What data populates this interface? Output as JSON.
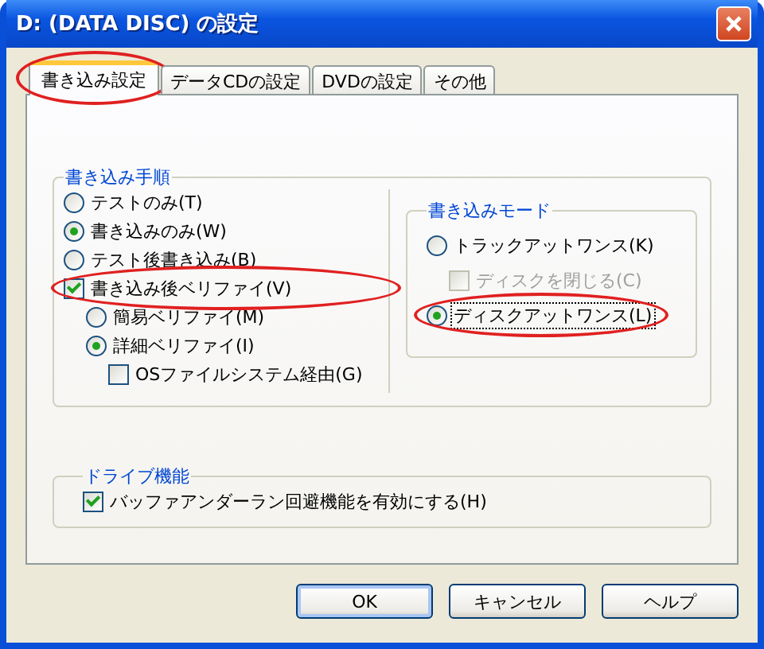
{
  "window": {
    "title": "D: (DATA DISC) の設定"
  },
  "tabs": [
    {
      "label": "書き込み設定",
      "selected": true,
      "circled": true
    },
    {
      "label": "データCDの設定",
      "selected": false,
      "circled": false
    },
    {
      "label": "DVDの設定",
      "selected": false,
      "circled": false
    },
    {
      "label": "その他",
      "selected": false,
      "circled": false
    }
  ],
  "write_procedure": {
    "title": "書き込み手順",
    "methods": [
      {
        "label": "テストのみ(T)",
        "selected": false
      },
      {
        "label": "書き込みのみ(W)",
        "selected": true
      },
      {
        "label": "テスト後書き込み(B)",
        "selected": false
      }
    ],
    "verify": {
      "label": "書き込み後ベリファイ(V)",
      "checked": true,
      "circled": true,
      "options": [
        {
          "label": "簡易ベリファイ(M)",
          "selected": false
        },
        {
          "label": "詳細ベリファイ(I)",
          "selected": true
        }
      ],
      "os_filesystem": {
        "label": "OSファイルシステム経由(G)",
        "checked": false
      }
    }
  },
  "write_mode": {
    "title": "書き込みモード",
    "options": [
      {
        "label": "トラックアットワンス(K)",
        "selected": false,
        "focused": false,
        "circled": false,
        "close_disc": {
          "label": "ディスクを閉じる(C)",
          "checked": false,
          "disabled": true
        }
      },
      {
        "label": "ディスクアットワンス(L)",
        "selected": true,
        "focused": true,
        "circled": true
      }
    ]
  },
  "drive": {
    "title": "ドライブ機能",
    "buffer_underrun": {
      "label": "バッファアンダーラン回避機能を有効にする(H)",
      "checked": true
    }
  },
  "buttons": [
    {
      "label": "OK",
      "default": true
    },
    {
      "label": "キャンセル",
      "default": false
    },
    {
      "label": "ヘルプ",
      "default": false
    }
  ]
}
